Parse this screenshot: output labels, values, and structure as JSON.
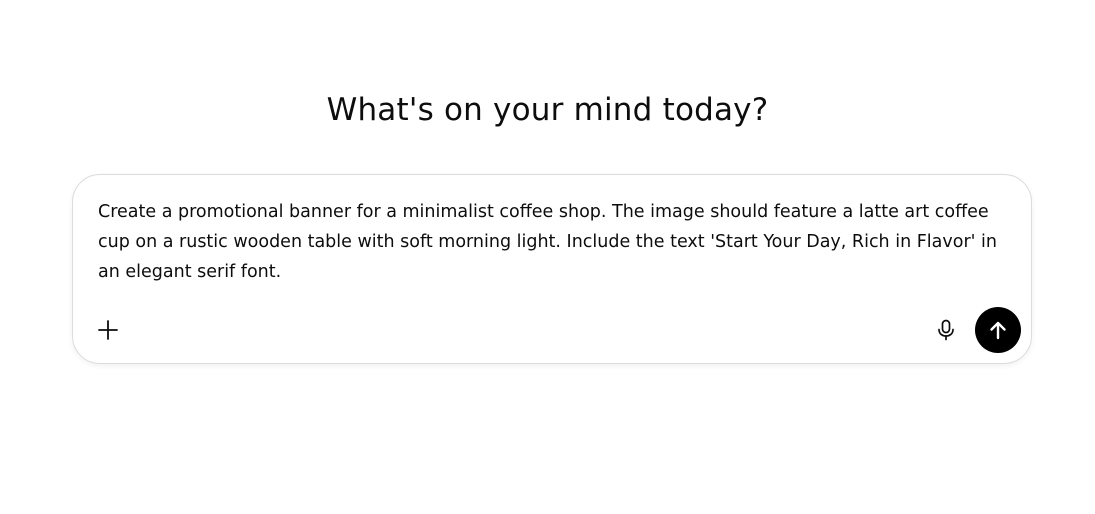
{
  "heading": "What's on your mind today?",
  "composer": {
    "prompt_text": "Create a promotional banner for a minimalist coffee shop. The image should feature a latte art coffee cup on a rustic wooden table with soft morning light. Include the text 'Start Your Day, Rich in Flavor' in an elegant serif font.",
    "icons": {
      "attach": "plus-icon",
      "voice": "microphone-icon",
      "send": "arrow-up-icon"
    },
    "send_button_color": "#000000"
  }
}
